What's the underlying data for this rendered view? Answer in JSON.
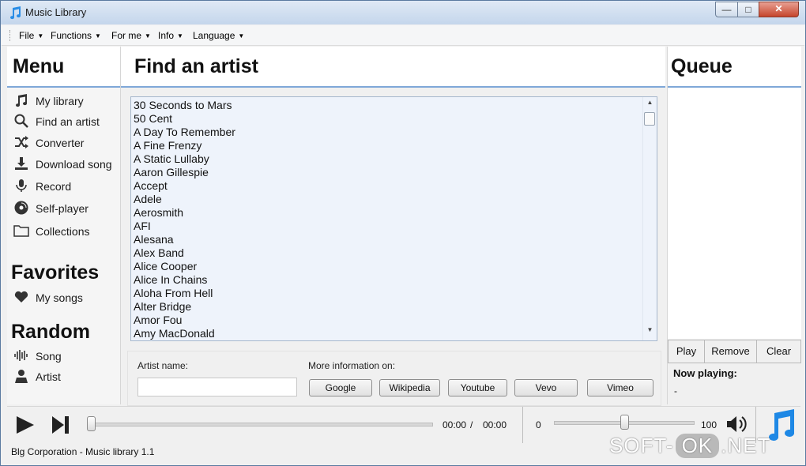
{
  "window": {
    "title": "Music Library"
  },
  "menubar": {
    "items": [
      {
        "label": "File"
      },
      {
        "label": "Functions"
      },
      {
        "label": "For me"
      },
      {
        "label": "Info"
      },
      {
        "label": "Language"
      }
    ]
  },
  "sidebar": {
    "menu_title": "Menu",
    "items": [
      {
        "label": "My library",
        "icon": "music-note-icon"
      },
      {
        "label": "Find an artist",
        "icon": "search-icon"
      },
      {
        "label": "Converter",
        "icon": "shuffle-icon"
      },
      {
        "label": "Download song",
        "icon": "download-icon"
      },
      {
        "label": "Record",
        "icon": "microphone-icon"
      },
      {
        "label": "Self-player",
        "icon": "disc-icon"
      },
      {
        "label": "Collections",
        "icon": "folder-icon"
      }
    ],
    "favorites_title": "Favorites",
    "favorites": [
      {
        "label": "My songs",
        "icon": "heart-icon"
      }
    ],
    "random_title": "Random",
    "random": [
      {
        "label": "Song",
        "icon": "waveform-icon"
      },
      {
        "label": "Artist",
        "icon": "person-icon"
      }
    ]
  },
  "main": {
    "title": "Find an artist",
    "artists": [
      "30 Seconds to Mars",
      "50 Cent",
      "A Day To Remember",
      "A Fine Frenzy",
      "A Static Lullaby",
      "Aaron Gillespie",
      "Accept",
      "Adele",
      "Aerosmith",
      "AFI",
      "Alesana",
      "Alex Band",
      "Alice Cooper",
      "Alice In Chains",
      "Aloha From Hell",
      "Alter Bridge",
      "Amor Fou",
      "Amy MacDonald"
    ],
    "artist_name_label": "Artist name:",
    "artist_name_value": "",
    "more_info_label": "More information on:",
    "info_buttons": [
      "Google",
      "Wikipedia",
      "Youtube",
      "Vevo",
      "Vimeo"
    ]
  },
  "queue": {
    "title": "Queue",
    "buttons": [
      "Play",
      "Remove",
      "Clear"
    ],
    "now_playing_label": "Now playing:",
    "now_playing_value": "-"
  },
  "player": {
    "current_time": "00:00",
    "separator": "/",
    "total_time": "00:00",
    "volume_min": "0",
    "volume_max": "100",
    "seek_fraction": 0.0,
    "volume_value": 50
  },
  "statusbar": {
    "text": "Blg Corporation - Music library 1.1"
  },
  "watermark": {
    "part1": "SOFT-",
    "part2": "OK",
    "part3": ".NET"
  },
  "colors": {
    "accent": "#7fa8d8",
    "brand_blue": "#1e88e5"
  }
}
